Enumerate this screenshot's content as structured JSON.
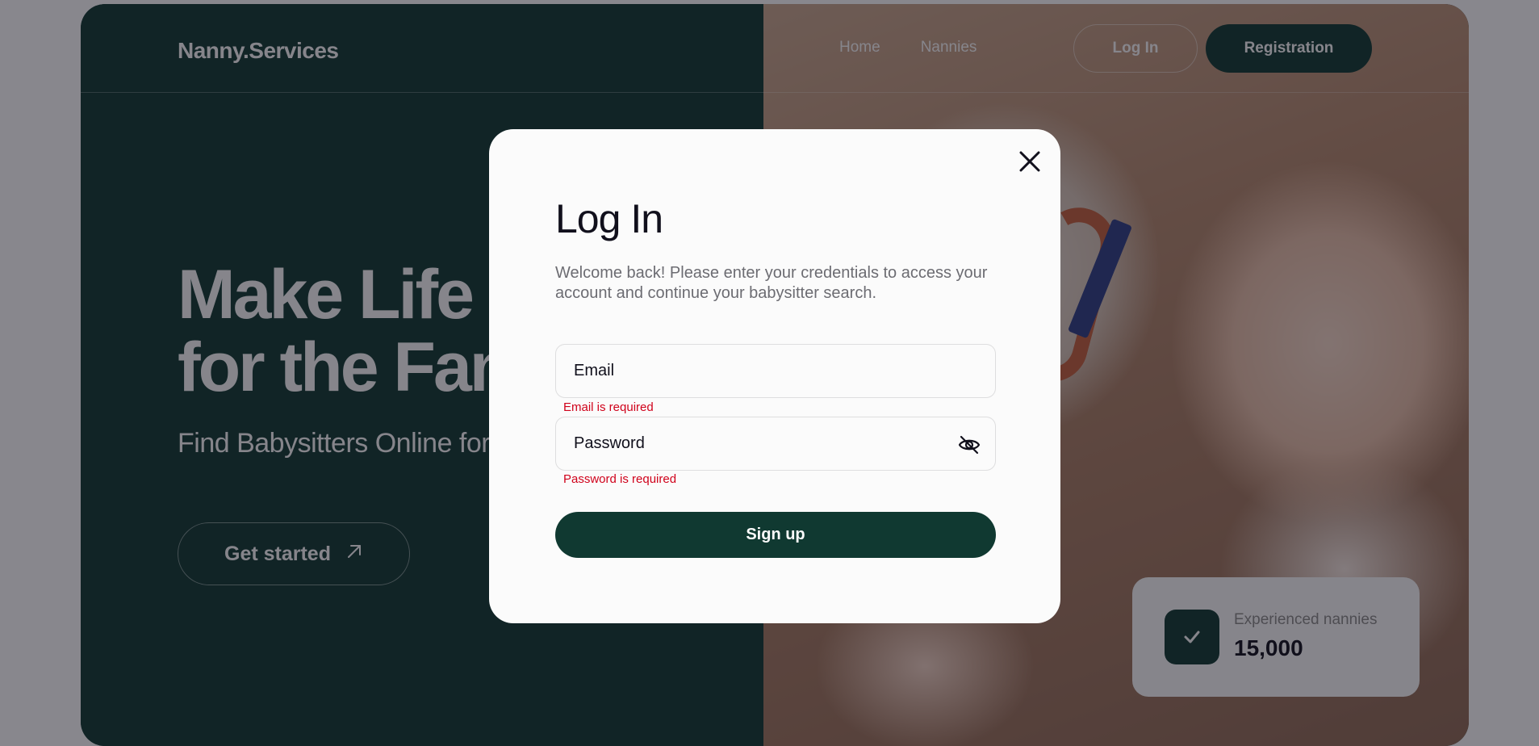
{
  "header": {
    "logo": "Nanny.Services",
    "nav": [
      {
        "label": "Home"
      },
      {
        "label": "Nannies"
      }
    ],
    "login_label": "Log In",
    "register_label": "Registration"
  },
  "hero": {
    "title": "Make Life Easier for the Family:",
    "subtitle": "Find Babysitters Online for All Occasions",
    "cta_label": "Get started",
    "cta_icon": "arrow-up-right-icon"
  },
  "stats": {
    "label": "Experienced nannies",
    "value": "15,000",
    "icon": "check-icon"
  },
  "modal": {
    "title": "Log In",
    "description": "Welcome back! Please enter your credentials to access your account and continue your babysitter search.",
    "email_placeholder": "Email",
    "email_error": "Email is required",
    "password_placeholder": "Password",
    "password_error": "Password is required",
    "password_toggle_icon": "eye-off-icon",
    "close_icon": "close-icon",
    "submit_label": "Sign up"
  },
  "colors": {
    "brand_dark_green": "#103931",
    "background_light": "#fbfbfb",
    "text_dark": "#11101c",
    "error_red": "#d0021b"
  }
}
